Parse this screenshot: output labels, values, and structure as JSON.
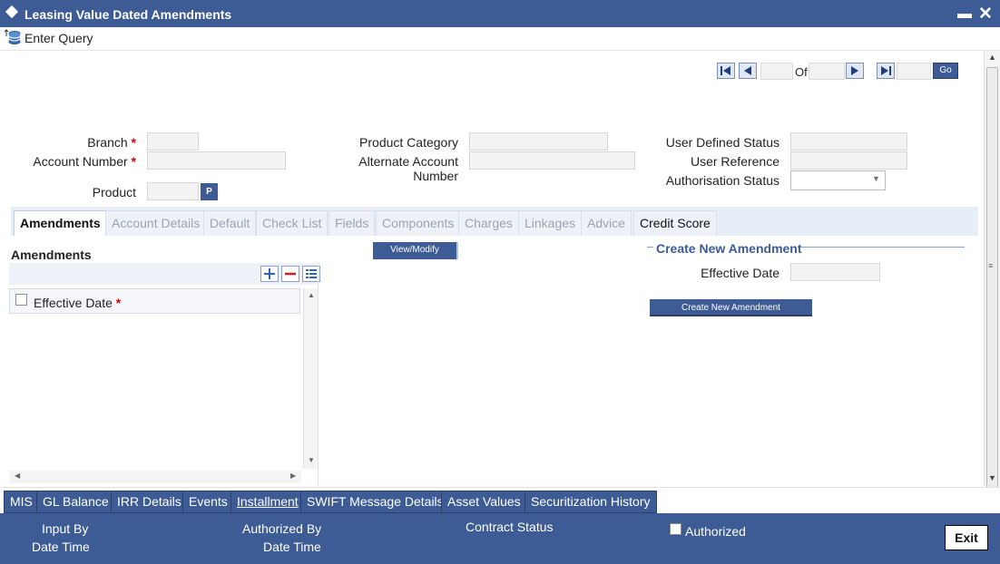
{
  "window": {
    "title": "Leasing Value Dated Amendments"
  },
  "toolbar": {
    "enter_query": "Enter Query"
  },
  "navigation": {
    "of_label": "Of",
    "go_label": "Go"
  },
  "header_fields": {
    "branch": {
      "label": "Branch",
      "value": ""
    },
    "account_number": {
      "label": "Account Number",
      "value": ""
    },
    "product": {
      "label": "Product",
      "value": "",
      "lookup_label": "P"
    },
    "product_category": {
      "label": "Product Category",
      "value": ""
    },
    "alternate_account_number": {
      "label_line1": "Alternate Account",
      "label_line2": "Number",
      "value": ""
    },
    "user_defined_status": {
      "label": "User Defined Status",
      "value": ""
    },
    "user_reference": {
      "label": "User Reference",
      "value": ""
    },
    "authorisation_status": {
      "label": "Authorisation Status",
      "value": ""
    }
  },
  "tabs": [
    {
      "label": "Amendments",
      "state": "active"
    },
    {
      "label": "Account Details",
      "state": "disabled"
    },
    {
      "label": "Default",
      "state": "disabled"
    },
    {
      "label": "Check List",
      "state": "disabled"
    },
    {
      "label": "Fields",
      "state": "disabled"
    },
    {
      "label": "Components",
      "state": "disabled"
    },
    {
      "label": "Charges",
      "state": "disabled"
    },
    {
      "label": "Linkages",
      "state": "disabled"
    },
    {
      "label": "Advice",
      "state": "disabled"
    },
    {
      "label": "Credit Score",
      "state": "enabled"
    }
  ],
  "amendments": {
    "section_title": "Amendments",
    "grid": {
      "columns": [
        "Effective Date"
      ],
      "rows": []
    },
    "view_modify_label": "View/Modify"
  },
  "create_new": {
    "section_title": "Create New Amendment",
    "effective_date_label": "Effective Date",
    "effective_date_value": "",
    "button_label": "Create New Amendment"
  },
  "bottom_tabs": [
    "MIS",
    "GL Balance",
    "IRR Details",
    "Events",
    "Installment",
    "SWIFT Message Details",
    "Asset Values",
    "Securitization History"
  ],
  "footer": {
    "input_by": "Input By",
    "date_time": "Date Time",
    "authorized_by": "Authorized By",
    "date_time_2": "Date Time",
    "contract_status": "Contract Status",
    "authorized": "Authorized",
    "exit": "Exit"
  },
  "icons": {
    "query": "database-icon",
    "first": "first-record-icon",
    "prev": "previous-record-icon",
    "next": "next-record-icon",
    "last": "last-record-icon",
    "add": "add-row-icon",
    "delete": "delete-row-icon",
    "view": "single-view-icon"
  },
  "colors": {
    "brand": "#3d5b94",
    "required": "#d80000"
  }
}
